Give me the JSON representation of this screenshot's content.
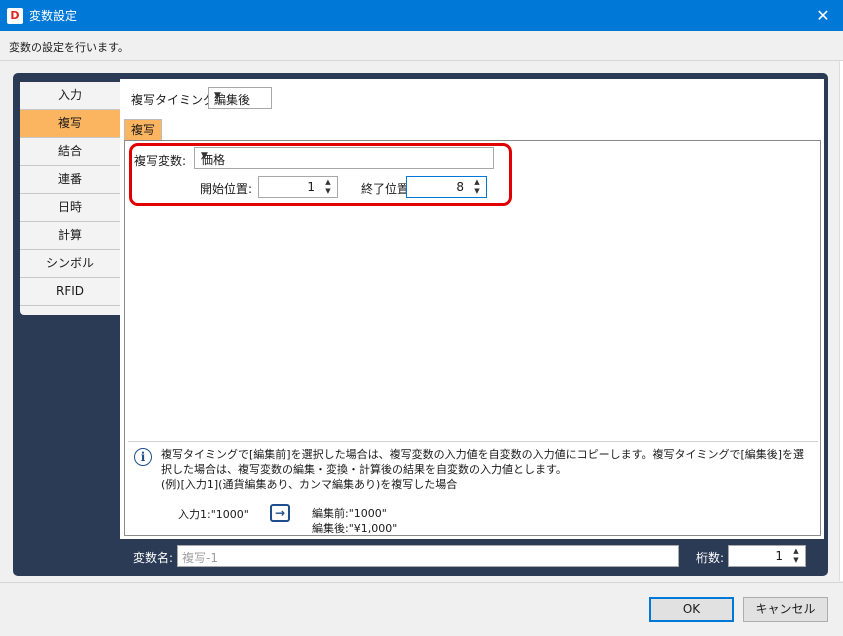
{
  "window": {
    "app_icon_letter": "D",
    "title": "変数設定",
    "close_glyph": "✕"
  },
  "description": "変数の設定を行います。",
  "side_tabs": [
    {
      "label": "入力",
      "active": false
    },
    {
      "label": "複写",
      "active": true
    },
    {
      "label": "結合",
      "active": false
    },
    {
      "label": "連番",
      "active": false
    },
    {
      "label": "日時",
      "active": false
    },
    {
      "label": "計算",
      "active": false
    },
    {
      "label": "シンボル",
      "active": false
    },
    {
      "label": "RFID",
      "active": false
    }
  ],
  "timing": {
    "label": "複写タイミング:",
    "value": "編集後"
  },
  "inner_tab_label": "複写",
  "copy_var": {
    "label": "複写変数:",
    "value": "価格"
  },
  "start": {
    "label": "開始位置:",
    "value": "1"
  },
  "end": {
    "label": "終了位置:",
    "value": "8"
  },
  "info": {
    "text": "複写タイミングで[編集前]を選択した場合は、複写変数の入力値を自変数の入力値にコピーします。複写タイミングで[編集後]を選択した場合は、複写変数の編集・変換・計算後の結果を自変数の入力値とします。",
    "example_title": "(例)[入力1](通貨編集あり、カンマ編集あり)を複写した場合",
    "example_input": "入力1:\"1000\"",
    "example_before": "編集前:\"1000\"",
    "example_after": "編集後:\"¥1,000\""
  },
  "var_name": {
    "label": "変数名:",
    "placeholder": "複写-1"
  },
  "digits": {
    "label": "桁数:",
    "value": "1"
  },
  "buttons": {
    "ok": "OK",
    "cancel": "キャンセル"
  },
  "colors": {
    "title_bar": "#0078d7",
    "panel": "#2b3a55",
    "active_tab": "#fbb45f",
    "highlight": "#e00000"
  }
}
